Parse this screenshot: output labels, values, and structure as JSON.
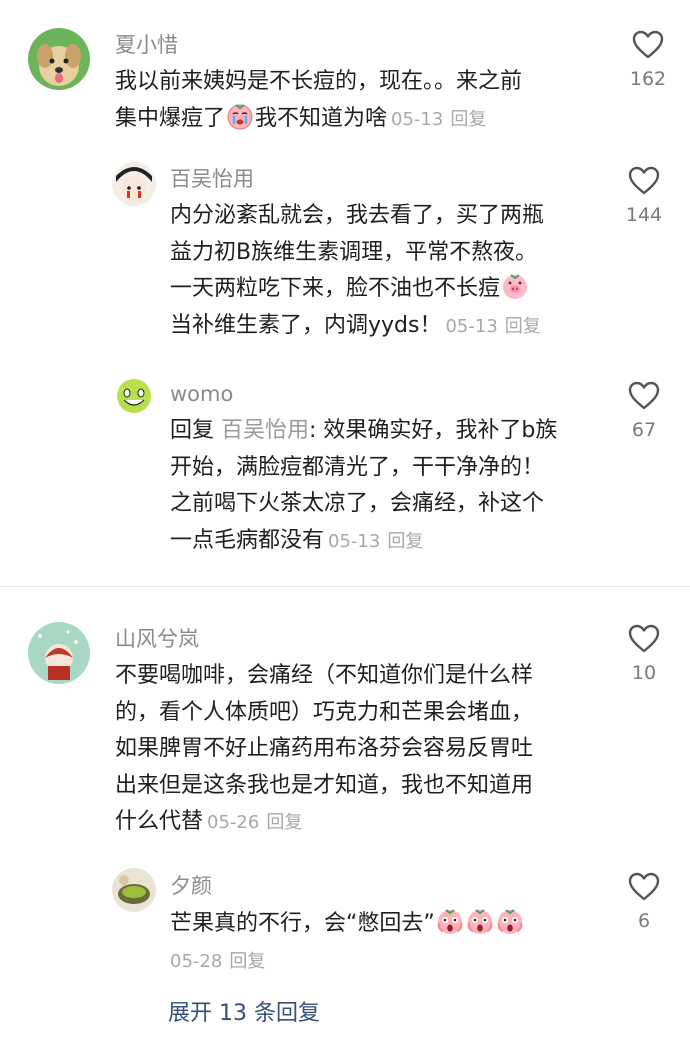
{
  "comments": [
    {
      "username": "夏小惜",
      "lines": [
        "我以前来姨妈是不长痘的，现在。。来之前",
        "集中爆痘了",
        "我不知道为啥"
      ],
      "date": "05-13",
      "reply_label": "回复",
      "likes": "162",
      "replies": [
        {
          "username": "百吴怡用",
          "lines": [
            "内分泌紊乱就会，我去看了，买了两瓶",
            "益力初B族维生素调理，平常不熬夜。",
            "一天两粒吃下来，脸不油也不长痘",
            "当补维生素了，内调yyds！"
          ],
          "date": "05-13",
          "reply_label": "回复",
          "likes": "144"
        },
        {
          "username": "womo",
          "reply_prefix": "回复",
          "reply_target": "百吴怡用",
          "lines": [
            ": 效果确实好，我补了b族",
            "开始，满脸痘都清光了，干干净净的！",
            "之前喝下火茶太凉了，会痛经，补这个",
            "一点毛病都没有"
          ],
          "date": "05-13",
          "reply_label": "回复",
          "likes": "67"
        }
      ]
    },
    {
      "username": "山风兮岚",
      "lines": [
        "不要喝咖啡，会痛经（不知道你们是什么样",
        "的，看个人体质吧）巧克力和芒果会堵血，",
        "如果脾胃不好止痛药用布洛芬会容易反胃吐",
        "出来但是这条我也是才知道，我也不知道用",
        "什么代替"
      ],
      "date": "05-26",
      "reply_label": "回复",
      "likes": "10",
      "replies": [
        {
          "username": "夕颜",
          "lines": [
            "芒果真的不行，会“憋回去”"
          ],
          "date": "05-28",
          "reply_label": "回复",
          "likes": "6"
        }
      ]
    }
  ],
  "expand_label": "展开 13 条回复",
  "colors": {
    "link": "#35507a",
    "meta": "#a8a8a8",
    "username": "#8a8a8a"
  },
  "icons": [
    "heart-icon",
    "crying-emoji",
    "pig-emoji",
    "scared-emoji"
  ]
}
